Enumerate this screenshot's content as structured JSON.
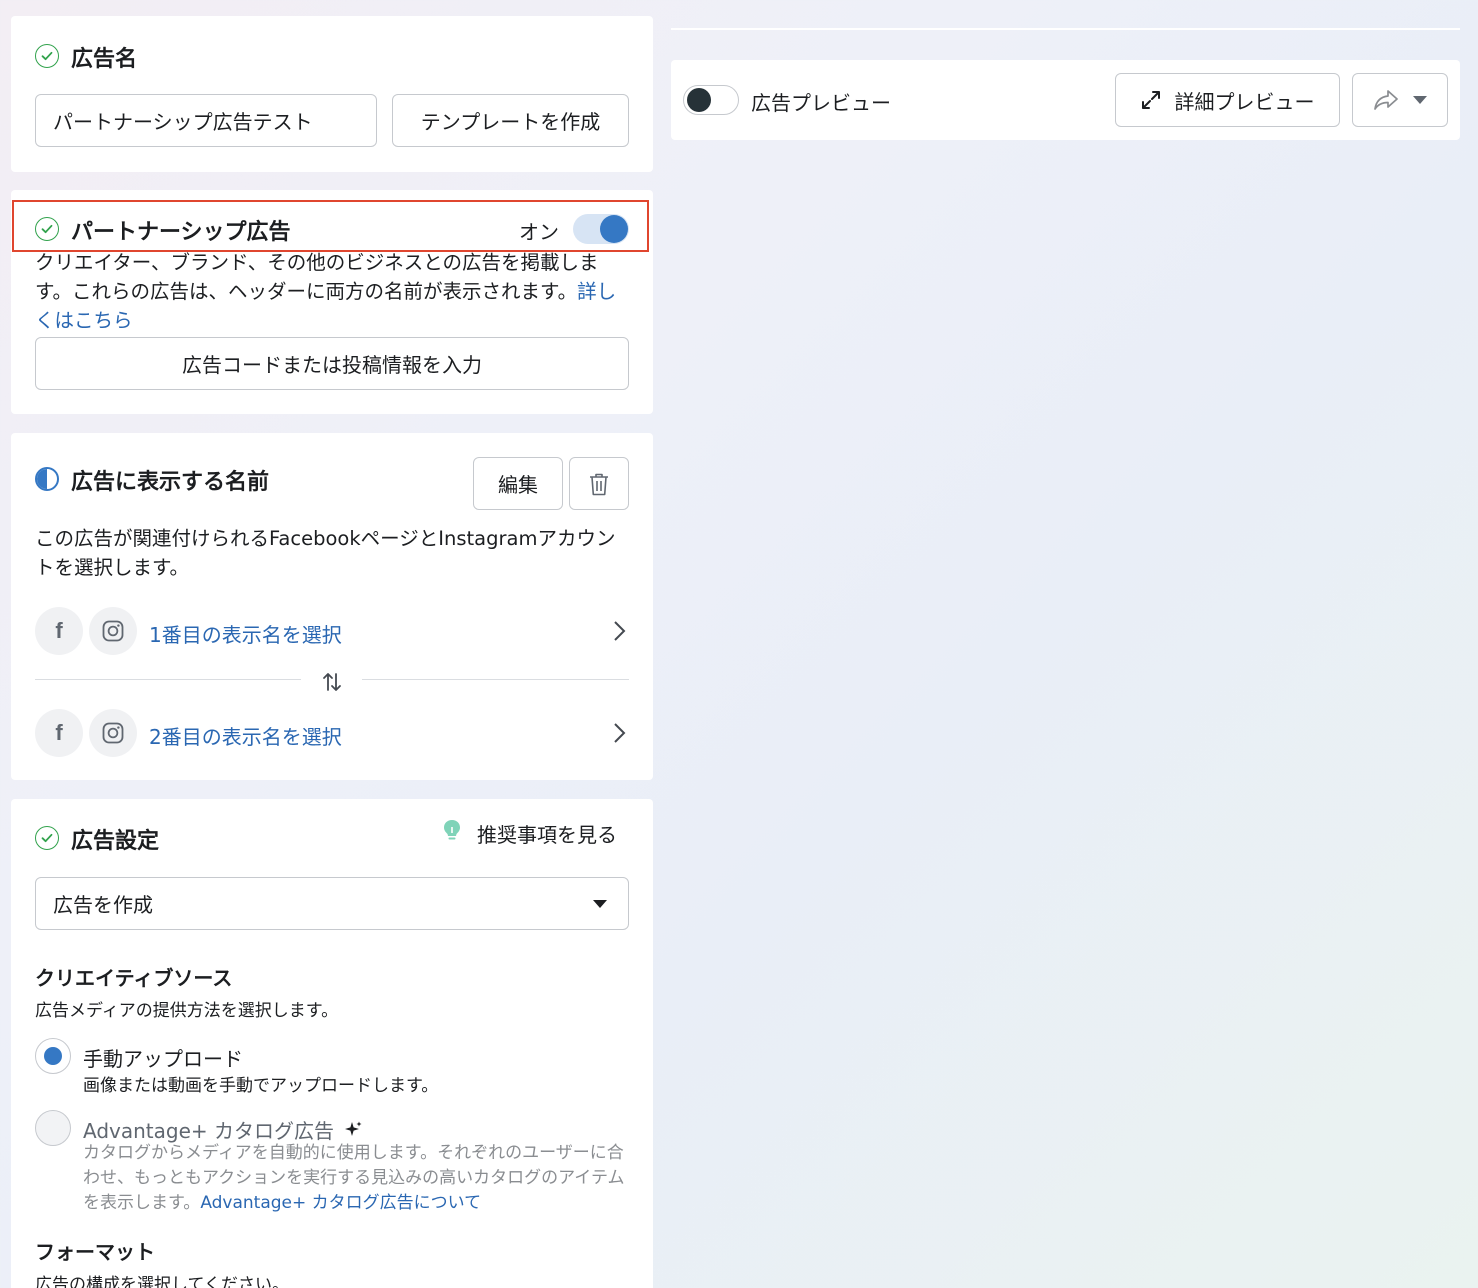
{
  "ad_name": {
    "title": "広告名",
    "value": "パートナーシップ広告テスト",
    "template_button": "テンプレートを作成"
  },
  "partnership": {
    "title": "パートナーシップ広告",
    "toggle_label": "オン",
    "toggle_on": true,
    "description": "クリエイター、ブランド、その他のビジネスとの広告を掲載します。これらの広告は、ヘッダーに両方の名前が表示されます。",
    "learn_more": "詳しくはこちら",
    "code_button": "広告コードまたは投稿情報を入力"
  },
  "display_name": {
    "title": "広告に表示する名前",
    "edit_button": "編集",
    "description": "この広告が関連付けられるFacebookページとInstagramアカウントを選択します。",
    "first_select": "1番目の表示名を選択",
    "second_select": "2番目の表示名を選択"
  },
  "ad_settings": {
    "title": "広告設定",
    "recommendations": "推奨事項を見る",
    "dropdown_value": "広告を作成",
    "creative_source_title": "クリエイティブソース",
    "creative_source_desc": "広告メディアの提供方法を選択します。",
    "options": [
      {
        "label": "手動アップロード",
        "desc": "画像または動画を手動でアップロードします。",
        "selected": true
      },
      {
        "label": "Advantage+ カタログ広告",
        "desc": "カタログからメディアを自動的に使用します。それぞれのユーザーに合わせ、もっともアクションを実行する見込みの高いカタログのアイテムを表示します。",
        "link": "Advantage+ カタログ広告について",
        "selected": false
      }
    ],
    "format_title": "フォーマット",
    "format_desc": "広告の構成を選択してください。"
  },
  "preview": {
    "toggle_label": "広告プレビュー",
    "toggle_on": false,
    "detail_button": "詳細プレビュー"
  },
  "colors": {
    "accent_blue": "#3578c4",
    "check_green": "#31a24c",
    "highlight_red": "#e0462f",
    "link_blue": "#2a67b2"
  }
}
